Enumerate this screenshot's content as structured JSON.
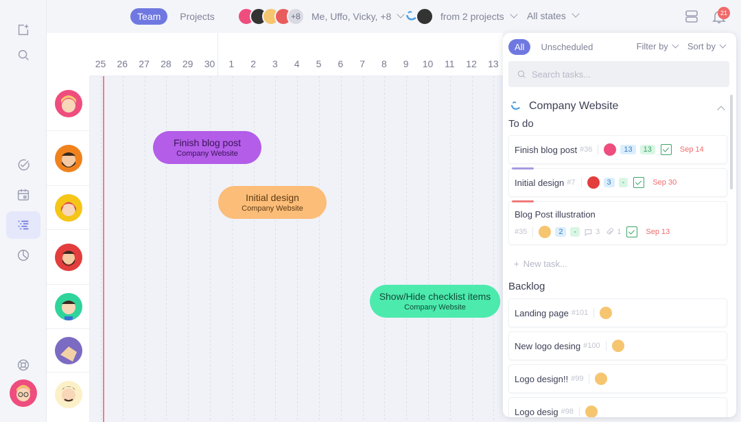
{
  "topbar": {
    "tabs": [
      {
        "label": "Team",
        "active": true
      },
      {
        "label": "Projects",
        "active": false
      }
    ],
    "people_more": "+8",
    "people_label": "Me, Uffo, Vicky, +8",
    "projects_label": "from 2 projects",
    "states_label": "All states",
    "notification_count": "21"
  },
  "timeline": {
    "dates": [
      "25",
      "26",
      "27",
      "28",
      "29",
      "30",
      "1",
      "2",
      "3",
      "4",
      "5",
      "6",
      "7",
      "8",
      "9",
      "10",
      "11",
      "12",
      "13"
    ],
    "bars": [
      {
        "title": "Finish blog post",
        "project": "Company Website",
        "color": "#b35de8"
      },
      {
        "title": "Initial design",
        "project": "Company Website",
        "color": "#fcbd78"
      },
      {
        "title": "Show/Hide checklist items",
        "project": "Company Website",
        "color": "#4deaae"
      }
    ]
  },
  "panel": {
    "tabs": [
      {
        "label": "All",
        "active": true
      },
      {
        "label": "Unscheduled",
        "active": false
      }
    ],
    "filter_label": "Filter by",
    "sort_label": "Sort by",
    "search_placeholder": "Search tasks...",
    "project_name": "Company Website",
    "todo_title": "To do",
    "todo": [
      {
        "title": "Finish blog post",
        "num": "#36",
        "chip1": "13",
        "chip2": "13",
        "due": "Sep 14"
      },
      {
        "title": "Initial design",
        "num": "#7",
        "chip1": "3",
        "chip2": "-",
        "due": "Sep 30"
      },
      {
        "title": "Blog Post illustration",
        "num": "#35",
        "chip1": "2",
        "chip2": "-",
        "comments": "3",
        "attachments": "1",
        "due": "Sep 13"
      }
    ],
    "new_task_label": "New task...",
    "backlog_title": "Backlog",
    "backlog": [
      {
        "title": "Landing page",
        "num": "#101"
      },
      {
        "title": "New logo desing",
        "num": "#100"
      },
      {
        "title": "Logo design!!",
        "num": "#99"
      },
      {
        "title": "Logo desig",
        "num": "#98"
      }
    ]
  },
  "colors": {
    "accent": "#6f78e0",
    "due": "#f06a6a"
  }
}
